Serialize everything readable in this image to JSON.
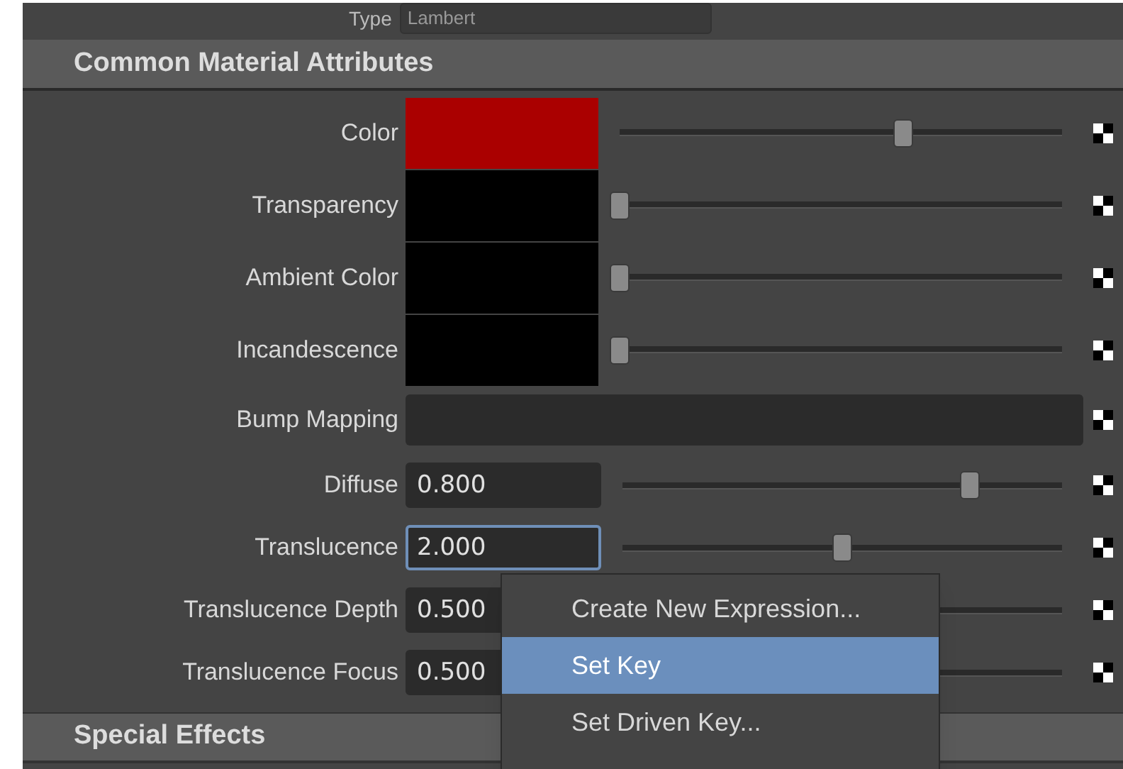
{
  "type_field": {
    "label": "Type",
    "value": "Lambert"
  },
  "sections": [
    {
      "title": "Common Material Attributes",
      "expanded": true,
      "attributes": [
        {
          "kind": "color",
          "label": "Color",
          "color": "#aa0000",
          "level": 0.64
        },
        {
          "kind": "color",
          "label": "Transparency",
          "color": "#000000",
          "level": 0
        },
        {
          "kind": "color",
          "label": "Ambient Color",
          "color": "#000000",
          "level": 0
        },
        {
          "kind": "color",
          "label": "Incandescence",
          "color": "#000000",
          "level": 0
        },
        {
          "kind": "map",
          "label": "Bump Mapping"
        },
        {
          "kind": "number",
          "label": "Diffuse",
          "value": "0.800",
          "focused": false,
          "level": 0.79
        },
        {
          "kind": "number",
          "label": "Translucence",
          "value": "2.000",
          "focused": true,
          "level": 0.5
        },
        {
          "kind": "number",
          "label": "Translucence Depth",
          "value": "0.500",
          "focused": false
        },
        {
          "kind": "number",
          "label": "Translucence Focus",
          "value": "0.500",
          "focused": false
        }
      ]
    },
    {
      "title": "Special Effects",
      "expanded": false
    }
  ],
  "context_menu": [
    {
      "label": "Create New Expression...",
      "selected": false
    },
    {
      "label": "Set Key",
      "selected": true
    },
    {
      "label": "Set Driven Key...",
      "selected": false
    }
  ]
}
